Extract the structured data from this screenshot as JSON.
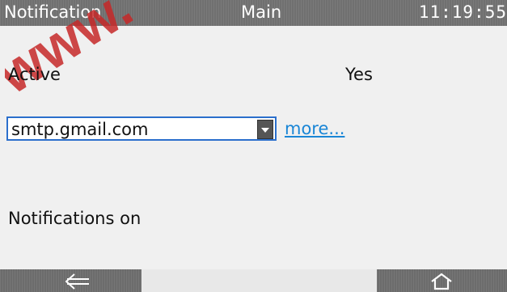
{
  "titlebar": {
    "left": "Notification",
    "center": "Main",
    "time": "11:19:55"
  },
  "fields": {
    "active_label": "Active",
    "active_value": "Yes",
    "smtp_server": "smtp.gmail.com",
    "more_link": "more...",
    "notifications_label": "Notifications on"
  },
  "footer": {
    "back_icon": "arrow-left-icon",
    "home_icon": "home-icon"
  },
  "colors": {
    "titlebar": "#707070",
    "link": "#1a86d6",
    "select_border": "#2b6fcc",
    "watermark": "#c62828"
  }
}
